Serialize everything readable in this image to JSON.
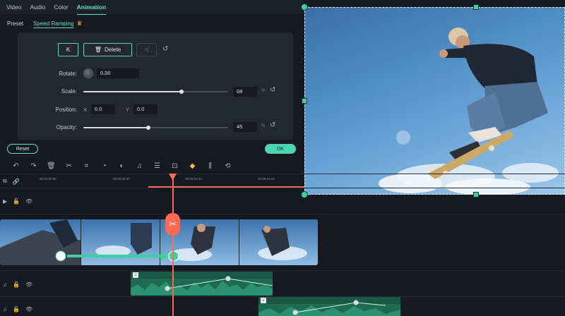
{
  "tabs": [
    {
      "label": "Video",
      "active": false
    },
    {
      "label": "Audio",
      "active": false
    },
    {
      "label": "Color",
      "active": false
    },
    {
      "label": "Animation",
      "active": true
    }
  ],
  "subtabs": [
    {
      "label": "Preset",
      "active": false
    },
    {
      "label": "Speed Ramping",
      "active": true
    }
  ],
  "keyframe": {
    "prev_icon": "K",
    "delete_label": "Delete",
    "next_icon": ">|"
  },
  "properties": {
    "rotate": {
      "label": "Rotate:",
      "value": "0.00"
    },
    "scale": {
      "label": "Scale:",
      "value": "68",
      "unit": "%",
      "level": 0.68
    },
    "position": {
      "label": "Position:",
      "x_label": "X",
      "x": "0.0",
      "y_label": "Y",
      "y": "0.0"
    },
    "opacity": {
      "label": "Opacity:",
      "value": "45",
      "unit": "%",
      "level": 0.45
    }
  },
  "footer": {
    "reset_label": "Reset",
    "ok_label": "OK"
  },
  "toolbar_icons": [
    "undo-icon",
    "redo-icon",
    "delete-icon",
    "cut-icon",
    "crop-icon",
    "speed-icon",
    "color-icon",
    "audio-icon",
    "adjust-icon",
    "stabilize-icon",
    "keyframe-icon",
    "split-audio-icon",
    "more-icon"
  ],
  "ruler": {
    "ticks": [
      "00:00:00:00",
      "00:00:05:00",
      "00:00:10:00",
      "00:00:15:00"
    ]
  },
  "colors": {
    "accent": "#4fd5b6",
    "playhead": "#ff6a57",
    "audio": "#1f6b52",
    "keyframe": "#f3c239"
  }
}
